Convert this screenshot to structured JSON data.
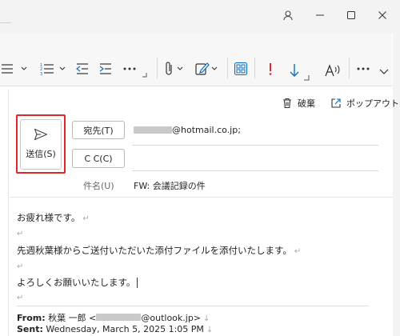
{
  "ribbon": {
    "buttons": [
      {
        "name": "bullets",
        "icon": "bullet-list-icon"
      },
      {
        "name": "numbering",
        "icon": "numbered-list-icon"
      },
      {
        "name": "decrease-indent",
        "icon": "decrease-indent-icon"
      },
      {
        "name": "increase-indent",
        "icon": "increase-indent-icon"
      },
      {
        "name": "more-format",
        "icon": "more-icon"
      },
      {
        "name": "attach",
        "icon": "paperclip-icon"
      },
      {
        "name": "signature",
        "icon": "signature-icon"
      },
      {
        "name": "apps",
        "icon": "apps-grid-icon"
      },
      {
        "name": "importance-high",
        "icon": "exclamation-icon"
      },
      {
        "name": "importance-low",
        "icon": "down-arrow-icon"
      },
      {
        "name": "read-aloud",
        "icon": "read-aloud-icon"
      },
      {
        "name": "more-ribbon",
        "icon": "more-icon"
      }
    ],
    "colors": {
      "high": "#e0262b",
      "low": "#0f6cbd",
      "apps": "#0f6cbd"
    }
  },
  "pane_toolbar": {
    "discard_label": "破棄",
    "popout_label": "ポップアウト"
  },
  "compose": {
    "send_label": "送信(S)",
    "to_button": "宛先(T)",
    "cc_button": "C C(C)",
    "to_value": "@hotmail.co.jp;",
    "subject_label": "件名(U)",
    "subject_value": "FW: 会議記録の件"
  },
  "body": {
    "line1": "お疲れ様です。",
    "line2": "先週秋葉様からご送付いただいた添付ファイルを添付いたします。",
    "line3": "よろしくお願いいたします。",
    "pilcrow": "↵"
  },
  "forwarded": {
    "from_label": "From:",
    "from_name": "秋葉 一郎 <",
    "from_domain": "@outlook.jp>",
    "sent_label": "Sent:",
    "sent_value": "Wednesday, March 5, 2025 1:05 PM"
  }
}
